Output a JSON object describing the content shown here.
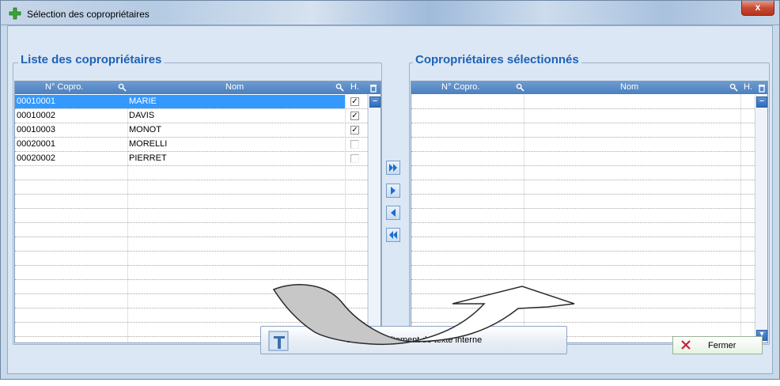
{
  "window": {
    "title": "Sélection des copropriétaires",
    "close_glyph": "x"
  },
  "left_group": {
    "title": "Liste des copropriétaires",
    "headers": {
      "num": "N° Copro.",
      "nom": "Nom",
      "h": "H."
    },
    "rows": [
      {
        "num": "00010001",
        "nom": "MARIE",
        "checked": true,
        "selected": true
      },
      {
        "num": "00010002",
        "nom": "DAVIS",
        "checked": true,
        "selected": false
      },
      {
        "num": "00010003",
        "nom": "MONOT",
        "checked": true,
        "selected": false
      },
      {
        "num": "00020001",
        "nom": "MORELLI",
        "checked": false,
        "selected": false
      },
      {
        "num": "00020002",
        "nom": "PIERRET",
        "checked": false,
        "selected": false
      }
    ],
    "empty_rows": 12
  },
  "right_group": {
    "title": "Copropriétaires sélectionnés",
    "headers": {
      "num": "N° Copro.",
      "nom": "Nom",
      "h": "H."
    },
    "rows": [],
    "empty_rows": 17
  },
  "transfer_buttons": [
    {
      "name": "add-all-button",
      "icon": "double-arrow-right-icon"
    },
    {
      "name": "add-one-button",
      "icon": "arrow-right-icon"
    },
    {
      "name": "remove-one-button",
      "icon": "arrow-left-icon"
    },
    {
      "name": "remove-all-button",
      "icon": "double-arrow-left-icon"
    }
  ],
  "buttons": {
    "word_processor": "Ouvrir le traitement de texte interne",
    "close": "Fermer"
  },
  "colors": {
    "group_title": "#1e62b6",
    "header_bg": "#4a7fc0",
    "selection": "#3399ff"
  }
}
